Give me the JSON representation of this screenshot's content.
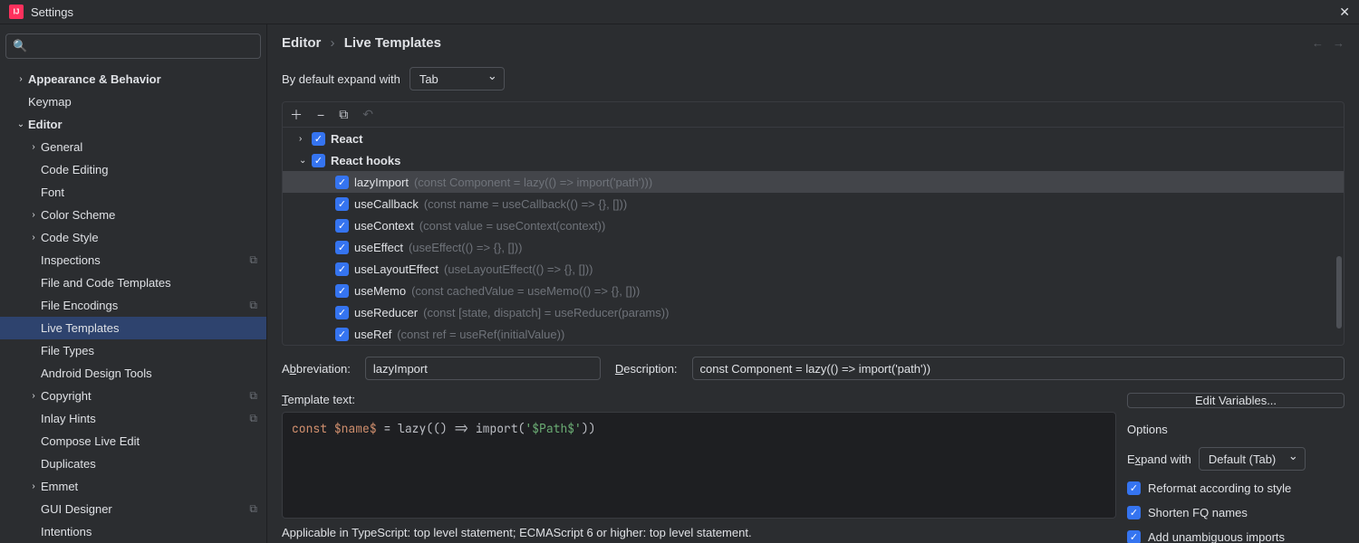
{
  "window": {
    "title": "Settings"
  },
  "breadcrumb": {
    "part1": "Editor",
    "part2": "Live Templates"
  },
  "expandDefault": {
    "label": "By default expand with",
    "value": "Tab"
  },
  "sidebar": {
    "items": [
      {
        "label": "Appearance & Behavior",
        "chevron": "›",
        "bold": true,
        "depth": 0
      },
      {
        "label": "Keymap",
        "depth": 0
      },
      {
        "label": "Editor",
        "chevron": "⌄",
        "bold": true,
        "depth": 0
      },
      {
        "label": "General",
        "chevron": "›",
        "depth": 1
      },
      {
        "label": "Code Editing",
        "depth": 1
      },
      {
        "label": "Font",
        "depth": 1
      },
      {
        "label": "Color Scheme",
        "chevron": "›",
        "depth": 1
      },
      {
        "label": "Code Style",
        "chevron": "›",
        "depth": 1
      },
      {
        "label": "Inspections",
        "depth": 1,
        "badge": "⧉"
      },
      {
        "label": "File and Code Templates",
        "depth": 1
      },
      {
        "label": "File Encodings",
        "depth": 1,
        "badge": "⧉"
      },
      {
        "label": "Live Templates",
        "depth": 1,
        "selected": true
      },
      {
        "label": "File Types",
        "depth": 1
      },
      {
        "label": "Android Design Tools",
        "depth": 1
      },
      {
        "label": "Copyright",
        "chevron": "›",
        "depth": 1,
        "badge": "⧉"
      },
      {
        "label": "Inlay Hints",
        "depth": 1,
        "badge": "⧉"
      },
      {
        "label": "Compose Live Edit",
        "depth": 1
      },
      {
        "label": "Duplicates",
        "depth": 1
      },
      {
        "label": "Emmet",
        "chevron": "›",
        "depth": 1
      },
      {
        "label": "GUI Designer",
        "depth": 1,
        "badge": "⧉"
      },
      {
        "label": "Intentions",
        "depth": 1
      }
    ]
  },
  "templates": {
    "groups": [
      {
        "name": "React",
        "chevron": "›",
        "expanded": false,
        "items": []
      },
      {
        "name": "React hooks",
        "chevron": "⌄",
        "expanded": true,
        "items": [
          {
            "name": "lazyImport",
            "desc": "(const Component = lazy(() => import('path')))",
            "selected": true
          },
          {
            "name": "useCallback",
            "desc": "(const name = useCallback(() => {}, []))"
          },
          {
            "name": "useContext",
            "desc": "(const value = useContext(context))"
          },
          {
            "name": "useEffect",
            "desc": "(useEffect(() => {}, []))"
          },
          {
            "name": "useLayoutEffect",
            "desc": "(useLayoutEffect(() => {}, []))"
          },
          {
            "name": "useMemo",
            "desc": "(const cachedValue = useMemo(() => {}, []))"
          },
          {
            "name": "useReducer",
            "desc": "(const [state, dispatch] = useReducer(params))"
          },
          {
            "name": "useRef",
            "desc": "(const ref = useRef(initialValue))"
          }
        ]
      }
    ]
  },
  "form": {
    "abbrevLabel": "Abbreviation:",
    "abbrevValue": "lazyImport",
    "descLabel": "Description:",
    "descValue": "const Component = lazy(() => import('path'))",
    "templateLabel": "Template text:",
    "editVarsLabel": "Edit Variables...",
    "optionsLabel": "Options",
    "expandWithLabel": "Expand with",
    "expandWithValue": "Default (Tab)",
    "opt1": "Reformat according to style",
    "opt2": "Shorten FQ names",
    "opt3": "Add unambiguous imports",
    "applicableText": "Applicable in TypeScript: top level statement; ECMAScript 6 or higher: top level statement."
  },
  "code": {
    "raw": "const $name$ = lazy(() => import('$Path$'))"
  }
}
